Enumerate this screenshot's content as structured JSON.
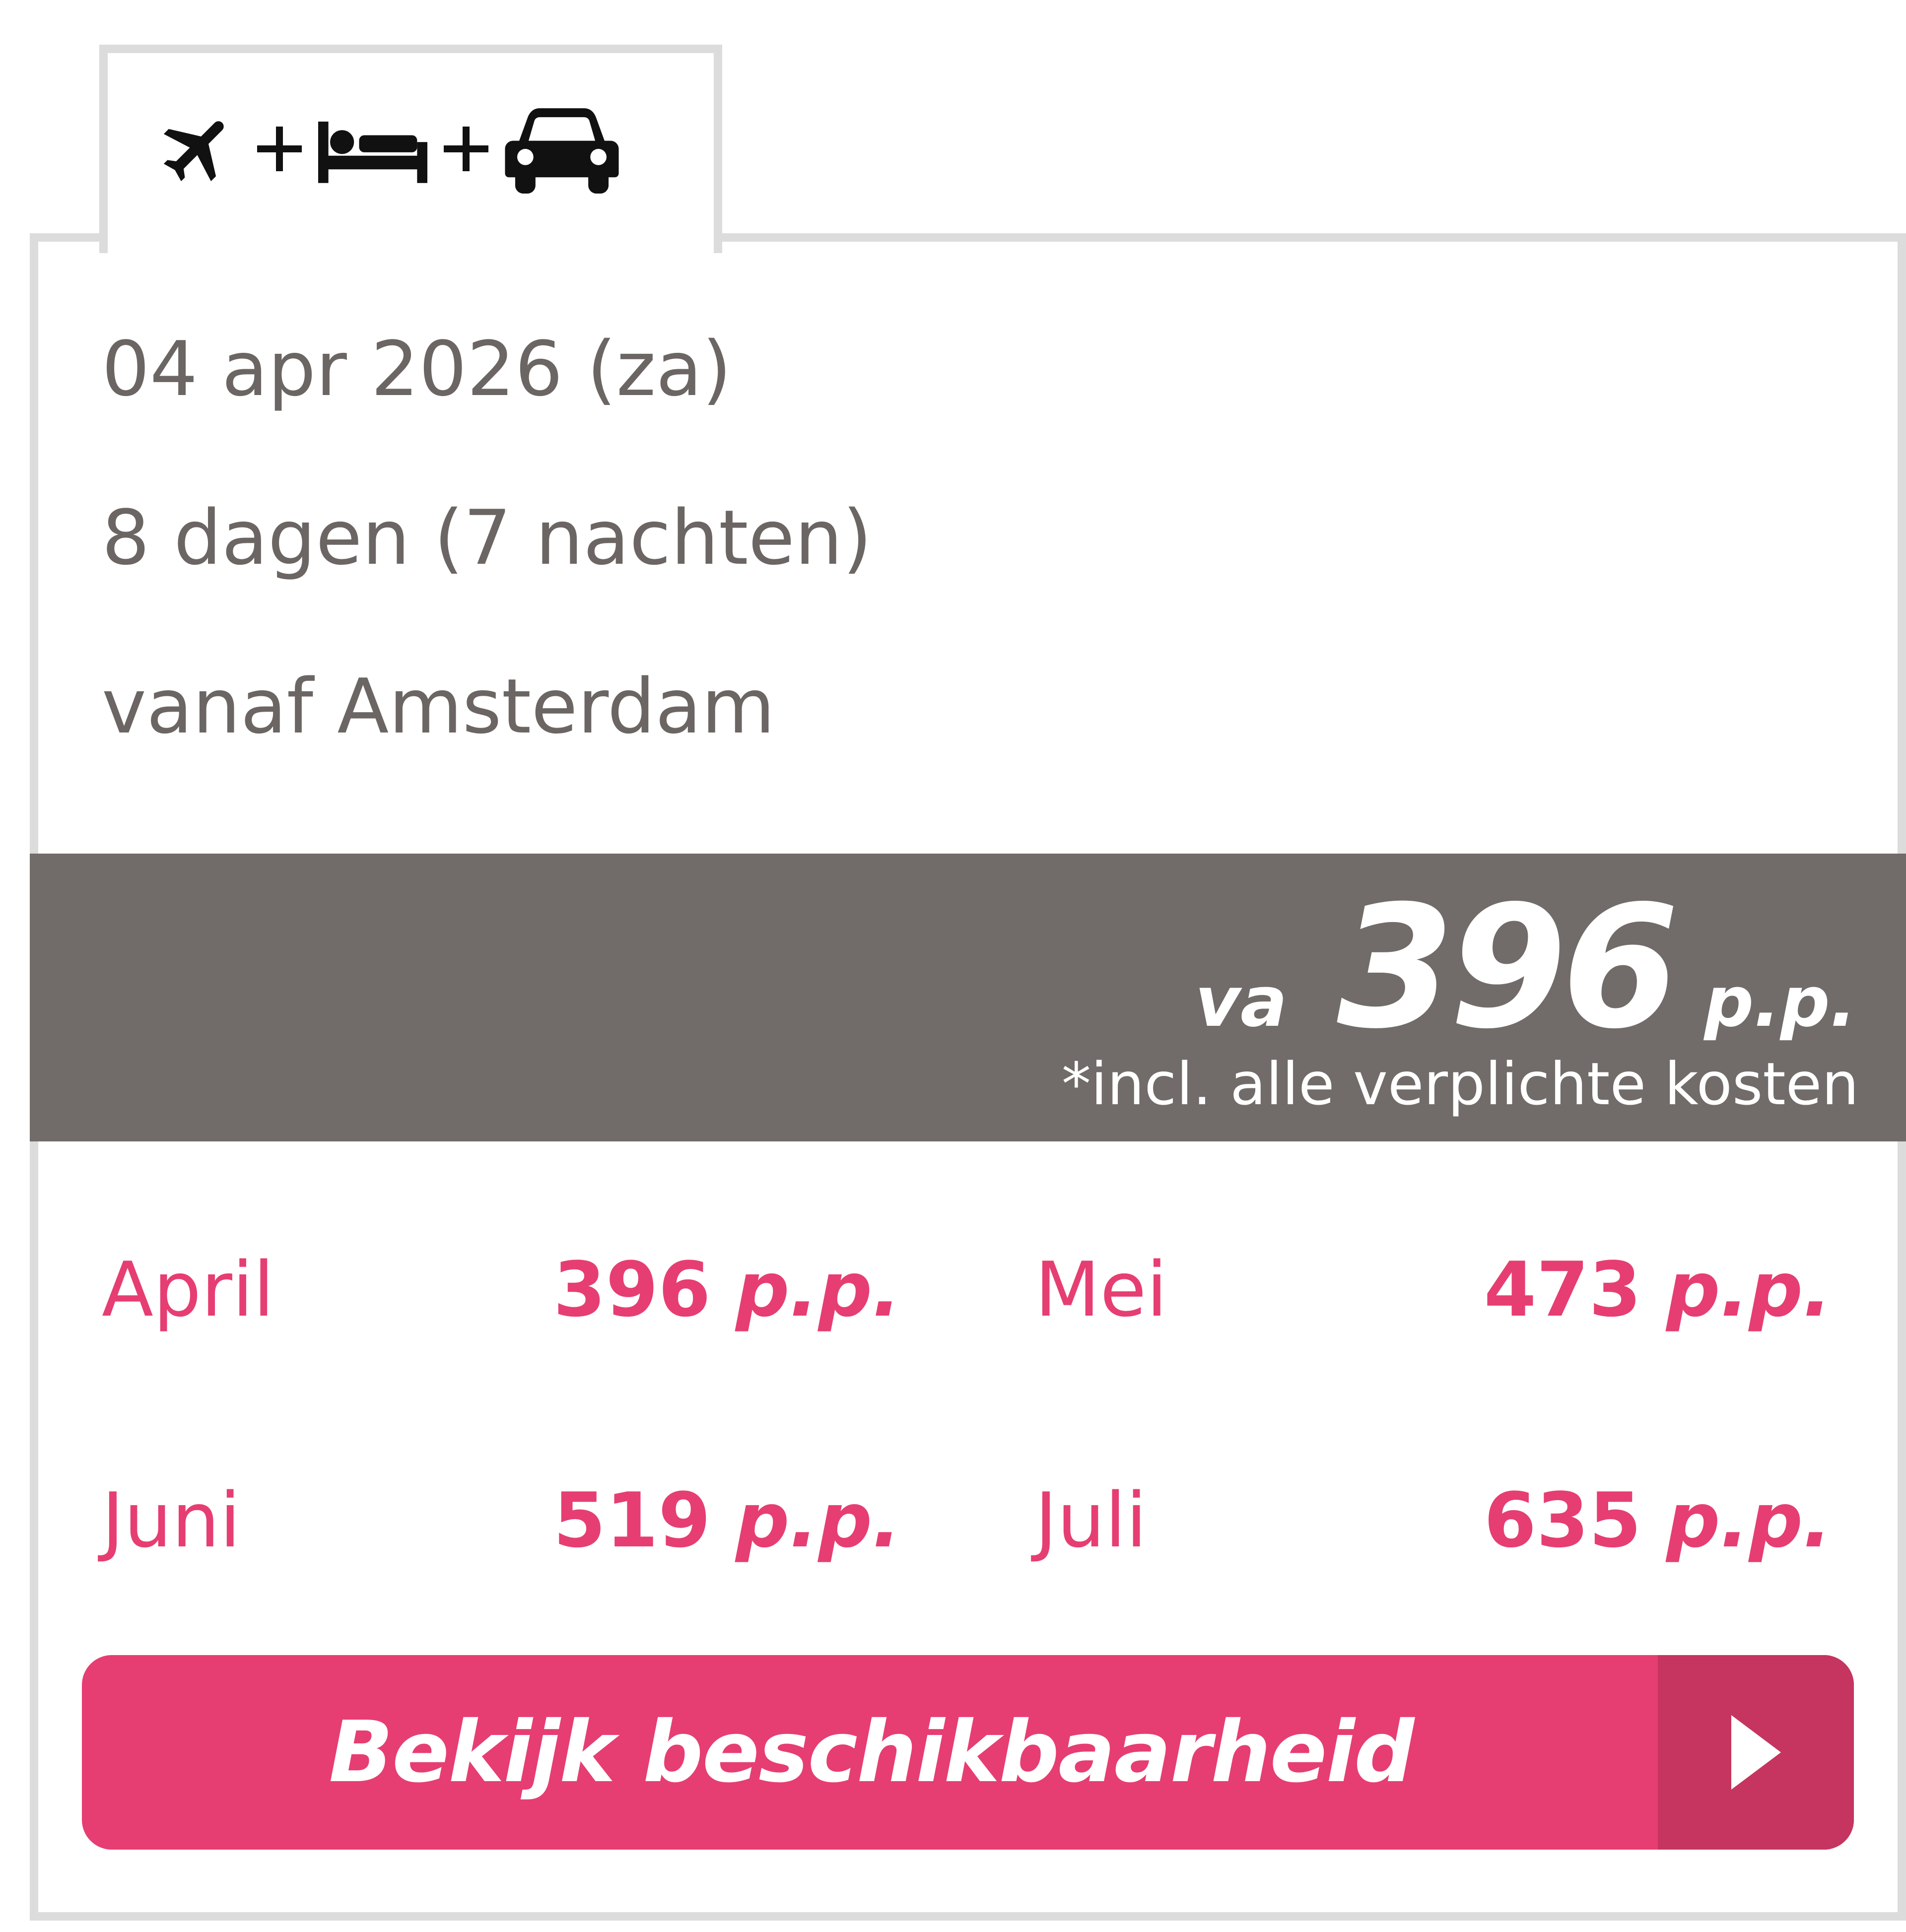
{
  "tab": {
    "icons": [
      "plane-icon",
      "plus-icon",
      "bed-icon",
      "plus-icon",
      "car-icon"
    ]
  },
  "details": {
    "date": "04 apr 2026 (za)",
    "duration": "8 dagen (7 nachten)",
    "departure": "vanaf Amsterdam"
  },
  "price": {
    "prefix": "va",
    "amount": "396",
    "unit": "p.p.",
    "note": "*incl. alle verplichte kosten"
  },
  "months": [
    {
      "name": "April",
      "price": "396",
      "unit": "p.p."
    },
    {
      "name": "Mei",
      "price": "473",
      "unit": "p.p."
    },
    {
      "name": "Juni",
      "price": "519",
      "unit": "p.p."
    },
    {
      "name": "Juli",
      "price": "635",
      "unit": "p.p."
    }
  ],
  "cta": {
    "label": "Bekijk beschikbaarheid",
    "icon": "arrow-right-icon"
  },
  "colors": {
    "accent": "#e63e72",
    "accent_dark": "#c5355f",
    "band": "#716c69",
    "text_muted": "#6b6663",
    "border": "#dcdcdc"
  }
}
